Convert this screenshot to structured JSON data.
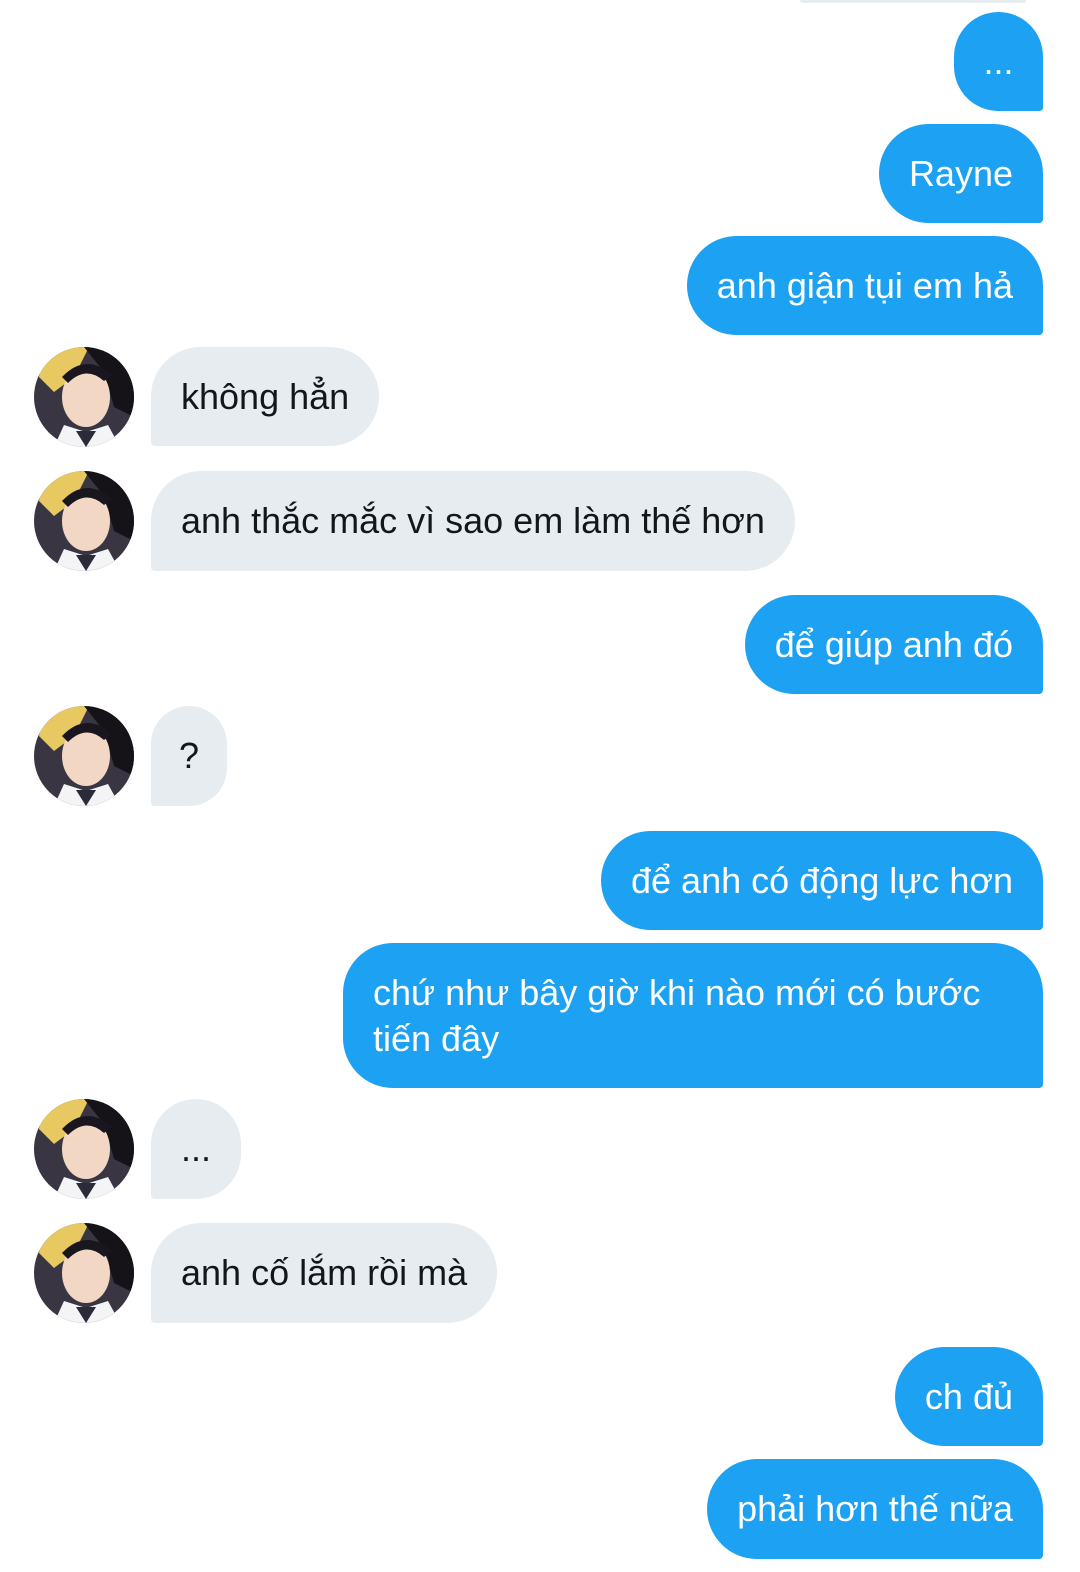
{
  "conversation": {
    "messages": [
      {
        "side": "outgoing",
        "text": "..."
      },
      {
        "side": "outgoing",
        "text": "Rayne"
      },
      {
        "side": "outgoing",
        "text": "anh giận tụi em hả"
      },
      {
        "side": "incoming",
        "text": "không hẳn"
      },
      {
        "side": "incoming",
        "text": "anh thắc mắc vì sao em làm thế hơn"
      },
      {
        "side": "outgoing",
        "text": "để giúp anh đó"
      },
      {
        "side": "incoming",
        "text": "?"
      },
      {
        "side": "outgoing",
        "text": "để anh có động lực hơn"
      },
      {
        "side": "outgoing",
        "text": "chứ như bây giờ khi nào mới có bước tiến đây"
      },
      {
        "side": "incoming",
        "text": "..."
      },
      {
        "side": "incoming",
        "text": "anh cố lắm rồi mà"
      },
      {
        "side": "outgoing",
        "text": "ch đủ"
      },
      {
        "side": "outgoing",
        "text": "phải hơn thế nữa"
      }
    ]
  },
  "colors": {
    "outgoing_bubble": "#1da1f2",
    "incoming_bubble": "#e6ecf0",
    "outgoing_text": "#ffffff",
    "incoming_text": "#14171a"
  },
  "icons": {
    "avatar": "anime-character-avatar"
  }
}
